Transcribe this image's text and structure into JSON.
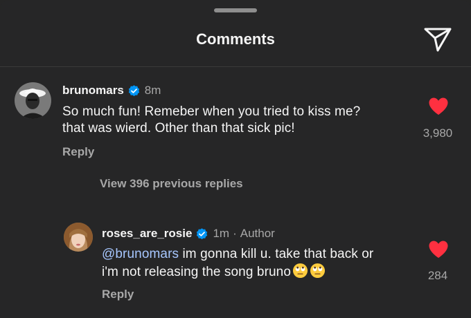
{
  "header": {
    "title": "Comments",
    "share_icon": "paper-plane-icon"
  },
  "comments": [
    {
      "username": "brunomars",
      "verified": true,
      "time": "8m",
      "line1": "So much fun! Remeber when you tried to kiss me?",
      "line2": "that was wierd. Other than that sick pic!",
      "likes": "3,980",
      "reply_label": "Reply",
      "liked": true
    }
  ],
  "view_replies": "View 396 previous replies",
  "replies": [
    {
      "username": "roses_are_rosie",
      "verified": true,
      "time": "1m",
      "separator": "·",
      "badge": "Author",
      "mention": "@brunomars",
      "line1_rest": " im gonna kill u. take that back or",
      "line2": "i'm not releasing the song bruno",
      "emojis": [
        "face-with-rolling-eyes",
        "face-with-rolling-eyes"
      ],
      "likes": "284",
      "reply_label": "Reply",
      "liked": true
    }
  ],
  "colors": {
    "background": "#262627",
    "like_red": "#ff3040",
    "verified_blue": "#0095f6",
    "mention": "#a7c7ff",
    "secondary_text": "#a8a8a8"
  }
}
